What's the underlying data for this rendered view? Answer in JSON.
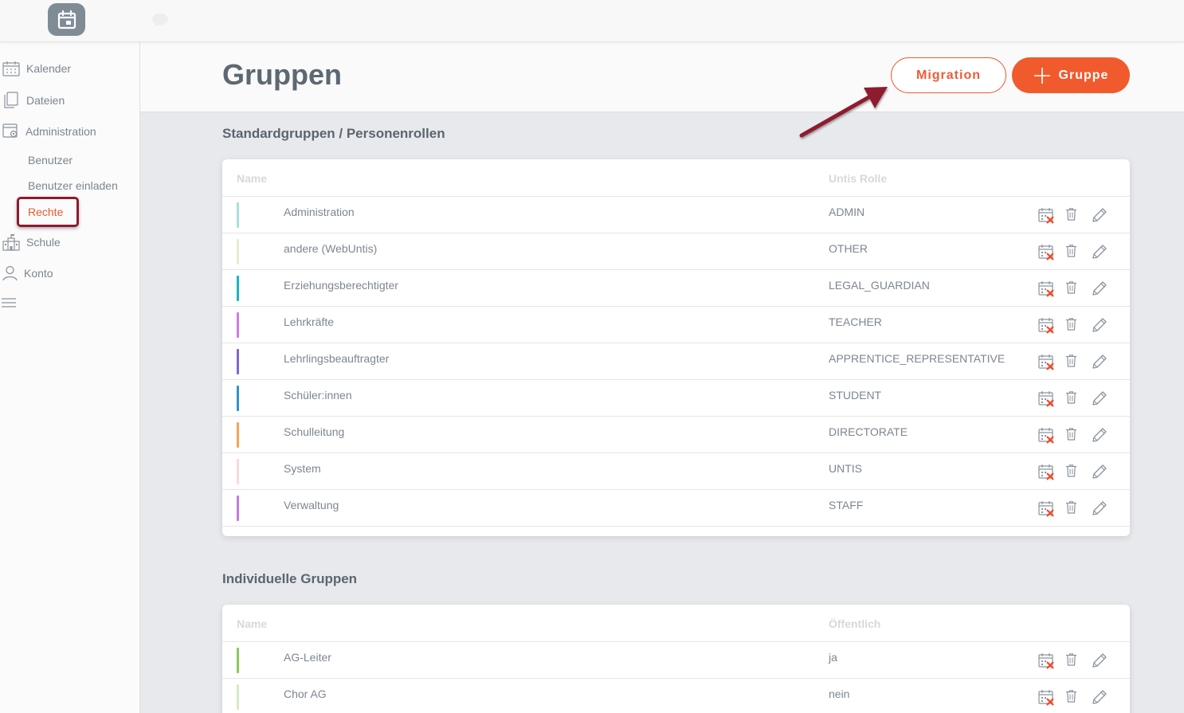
{
  "app": {
    "logo_icon": "calendar-icon",
    "chat_icon": "speech-bubble-icon"
  },
  "sidebar": {
    "items": [
      {
        "label": "Kalender",
        "icon": "calendar-icon"
      },
      {
        "label": "Dateien",
        "icon": "files-icon"
      },
      {
        "label": "Administration",
        "icon": "admin-gear-icon"
      },
      {
        "label": "Schule",
        "icon": "school-icon"
      },
      {
        "label": "Konto",
        "icon": "person-icon"
      }
    ],
    "subitems": [
      {
        "label": "Benutzer"
      },
      {
        "label": "Benutzer einladen"
      },
      {
        "label": "Rechte"
      }
    ],
    "menu_icon": "hamburger-icon"
  },
  "header": {
    "title": "Gruppen",
    "migration_label": "Migration",
    "add_group_label": "Gruppe"
  },
  "standard": {
    "title": "Standardgruppen / Personenrollen",
    "col_name": "Name",
    "col_role": "Untis Rolle",
    "rows": [
      {
        "name": "Administration",
        "role": "ADMIN",
        "color": "#a8e0de"
      },
      {
        "name": "andere (WebUntis)",
        "role": "OTHER",
        "color": "#e3efcf"
      },
      {
        "name": "Erziehungsberechtigter",
        "role": "LEGAL_GUARDIAN",
        "color": "#1fb3bf"
      },
      {
        "name": "Lehrkräfte",
        "role": "TEACHER",
        "color": "#d07be3"
      },
      {
        "name": "Lehrlingsbeauftragter",
        "role": "APPRENTICE_REPRESENTATIVE",
        "color": "#8267cf"
      },
      {
        "name": "Schüler:innen",
        "role": "STUDENT",
        "color": "#3492c9"
      },
      {
        "name": "Schulleitung",
        "role": "DIRECTORATE",
        "color": "#f3a55a"
      },
      {
        "name": "System",
        "role": "UNTIS",
        "color": "#f8d9dc"
      },
      {
        "name": "Verwaltung",
        "role": "STAFF",
        "color": "#c67be0"
      }
    ]
  },
  "individual": {
    "title": "Individuelle Gruppen",
    "col_name": "Name",
    "col_public": "Öffentlich",
    "rows": [
      {
        "name": "AG-Leiter",
        "public": "ja",
        "color": "#8cc95c"
      },
      {
        "name": "Chor AG",
        "public": "nein",
        "color": "#d6ebc4"
      }
    ]
  },
  "actions": {
    "calendar_remove_icon": "calendar-remove-icon",
    "delete_icon": "trash-icon",
    "edit_icon": "pencil-icon"
  },
  "colors": {
    "accent": "#f15a2d",
    "highlight": "#8e1a2e"
  }
}
